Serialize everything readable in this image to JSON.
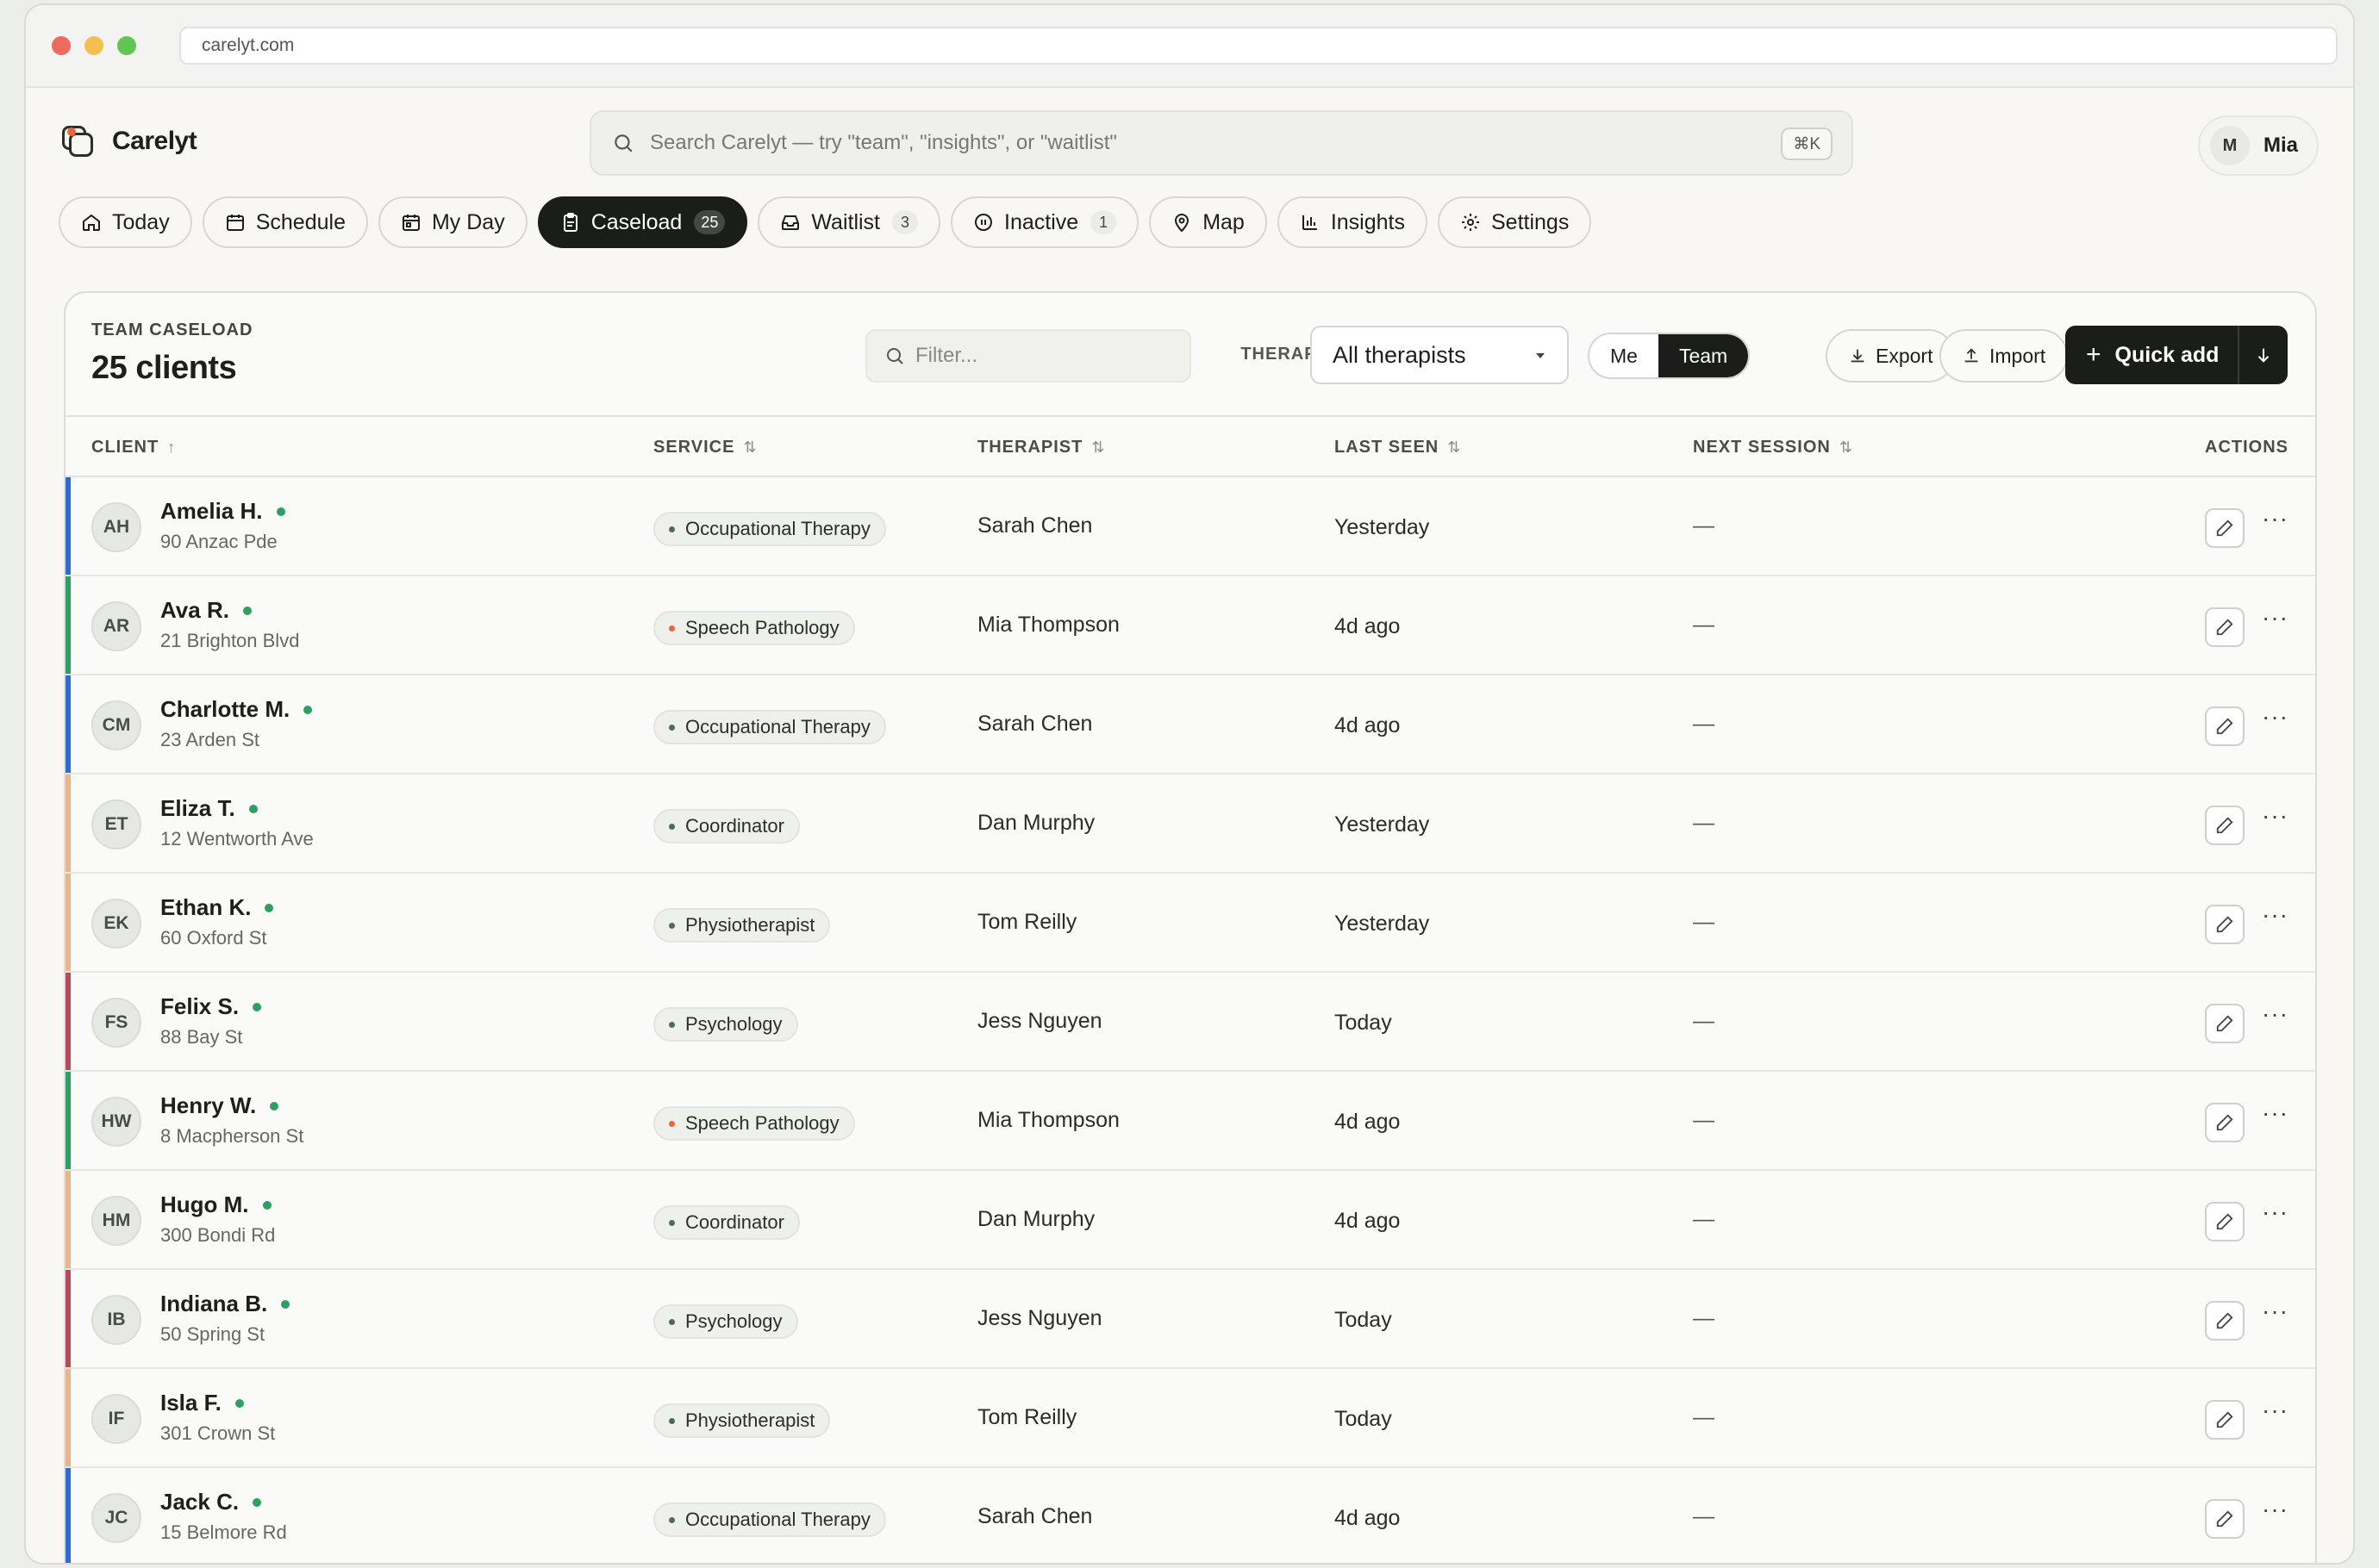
{
  "browser": {
    "url": "carelyt.com"
  },
  "app": {
    "name": "Carelyt"
  },
  "search": {
    "placeholder": "Search Carelyt — try \"team\", \"insights\", or \"waitlist\"",
    "shortcut": "⌘K"
  },
  "user": {
    "initial": "M",
    "name": "Mia"
  },
  "tabs": [
    {
      "label": "Today",
      "icon": "home-icon"
    },
    {
      "label": "Schedule",
      "icon": "calendar-icon"
    },
    {
      "label": "My Day",
      "icon": "calendar-day-icon"
    },
    {
      "label": "Caseload",
      "icon": "clipboard-icon",
      "badge": "25",
      "active": true
    },
    {
      "label": "Waitlist",
      "icon": "inbox-icon",
      "badge": "3"
    },
    {
      "label": "Inactive",
      "icon": "pause-icon",
      "badge": "1"
    },
    {
      "label": "Map",
      "icon": "map-pin-icon"
    },
    {
      "label": "Insights",
      "icon": "chart-icon"
    },
    {
      "label": "Settings",
      "icon": "gear-icon"
    }
  ],
  "card": {
    "eyebrow": "TEAM CASELOAD",
    "count": "25 clients",
    "filter_placeholder": "Filter...",
    "therapists_label": "THERAPISTS",
    "therapist_select": "All therapists",
    "toggle": {
      "me": "Me",
      "team": "Team"
    },
    "export": "Export",
    "import": "Import",
    "quick_add": "Quick add"
  },
  "columns": {
    "client": "CLIENT",
    "service": "SERVICE",
    "therapist": "THERAPIST",
    "last_seen": "LAST SEEN",
    "next_session": "NEXT SESSION",
    "actions": "ACTIONS"
  },
  "colors": {
    "occupational": "#2f6bd0",
    "speech": "#2f9e62",
    "coordinator": "#e8b488",
    "physio": "#e8b488",
    "psychology": "#b84a57",
    "speech_dot": "#e8683c",
    "default_dot": "#4d6c57"
  },
  "rows": [
    {
      "initials": "AH",
      "name": "Amelia H.",
      "address": "90 Anzac Pde",
      "service": "Occupational Therapy",
      "stripe": "occupational",
      "therapist": "Sarah Chen",
      "last_seen": "Yesterday",
      "next": "—"
    },
    {
      "initials": "AR",
      "name": "Ava R.",
      "address": "21 Brighton Blvd",
      "service": "Speech Pathology",
      "stripe": "speech",
      "therapist": "Mia Thompson",
      "last_seen": "4d ago",
      "next": "—"
    },
    {
      "initials": "CM",
      "name": "Charlotte M.",
      "address": "23 Arden St",
      "service": "Occupational Therapy",
      "stripe": "occupational",
      "therapist": "Sarah Chen",
      "last_seen": "4d ago",
      "next": "—"
    },
    {
      "initials": "ET",
      "name": "Eliza T.",
      "address": "12 Wentworth Ave",
      "service": "Coordinator",
      "stripe": "coordinator",
      "therapist": "Dan Murphy",
      "last_seen": "Yesterday",
      "next": "—"
    },
    {
      "initials": "EK",
      "name": "Ethan K.",
      "address": "60 Oxford St",
      "service": "Physiotherapist",
      "stripe": "physio",
      "therapist": "Tom Reilly",
      "last_seen": "Yesterday",
      "next": "—"
    },
    {
      "initials": "FS",
      "name": "Felix S.",
      "address": "88 Bay St",
      "service": "Psychology",
      "stripe": "psychology",
      "therapist": "Jess Nguyen",
      "last_seen": "Today",
      "next": "—"
    },
    {
      "initials": "HW",
      "name": "Henry W.",
      "address": "8 Macpherson St",
      "service": "Speech Pathology",
      "stripe": "speech",
      "therapist": "Mia Thompson",
      "last_seen": "4d ago",
      "next": "—"
    },
    {
      "initials": "HM",
      "name": "Hugo M.",
      "address": "300 Bondi Rd",
      "service": "Coordinator",
      "stripe": "coordinator",
      "therapist": "Dan Murphy",
      "last_seen": "4d ago",
      "next": "—"
    },
    {
      "initials": "IB",
      "name": "Indiana B.",
      "address": "50 Spring St",
      "service": "Psychology",
      "stripe": "psychology",
      "therapist": "Jess Nguyen",
      "last_seen": "Today",
      "next": "—"
    },
    {
      "initials": "IF",
      "name": "Isla F.",
      "address": "301 Crown St",
      "service": "Physiotherapist",
      "stripe": "physio",
      "therapist": "Tom Reilly",
      "last_seen": "Today",
      "next": "—"
    },
    {
      "initials": "JC",
      "name": "Jack C.",
      "address": "15 Belmore Rd",
      "service": "Occupational Therapy",
      "stripe": "occupational",
      "therapist": "Sarah Chen",
      "last_seen": "4d ago",
      "next": "—"
    }
  ]
}
